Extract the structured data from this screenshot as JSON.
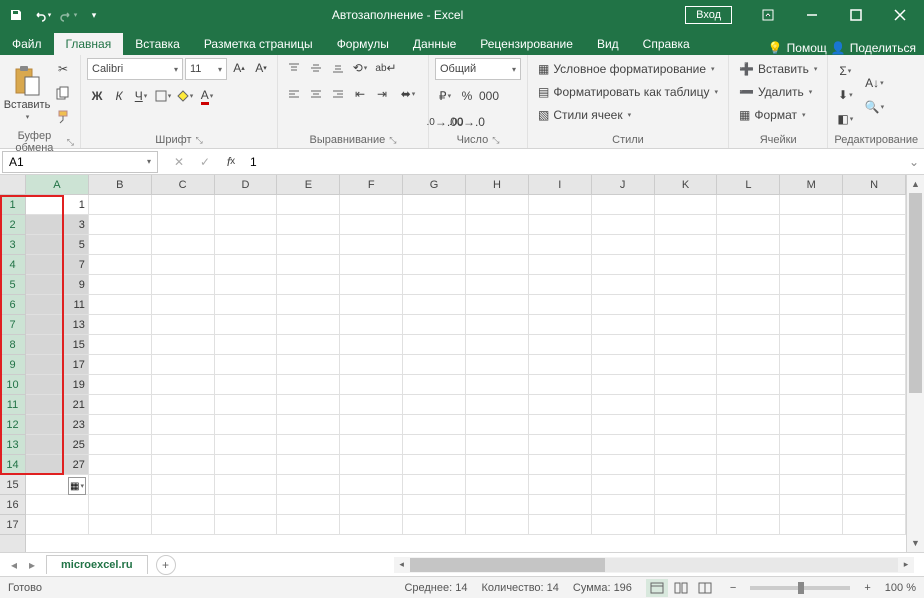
{
  "title": "Автозаполнение  -  Excel",
  "login": "Вход",
  "tabs": {
    "file": "Файл",
    "home": "Главная",
    "insert": "Вставка",
    "layout": "Разметка страницы",
    "formulas": "Формулы",
    "data": "Данные",
    "review": "Рецензирование",
    "view": "Вид",
    "help": "Справка",
    "tellme": "Помощ",
    "share": "Поделиться"
  },
  "ribbon": {
    "clipboard": {
      "paste": "Вставить",
      "label": "Буфер обмена"
    },
    "font": {
      "name": "Calibri",
      "size": "11",
      "label": "Шрифт"
    },
    "align": {
      "label": "Выравнивание"
    },
    "number": {
      "format": "Общий",
      "label": "Число"
    },
    "styles": {
      "cond": "Условное форматирование",
      "table": "Форматировать как таблицу",
      "cell": "Стили ячеек",
      "label": "Стили"
    },
    "cells": {
      "insert": "Вставить",
      "delete": "Удалить",
      "format": "Формат",
      "label": "Ячейки"
    },
    "editing": {
      "label": "Редактирование"
    }
  },
  "namebox": "A1",
  "formula": "1",
  "columns": [
    "A",
    "B",
    "C",
    "D",
    "E",
    "F",
    "G",
    "H",
    "I",
    "J",
    "K",
    "L",
    "M",
    "N"
  ],
  "rows": [
    1,
    2,
    3,
    4,
    5,
    6,
    7,
    8,
    9,
    10,
    11,
    12,
    13,
    14,
    15,
    16,
    17
  ],
  "cellData": {
    "A1": "1",
    "A2": "3",
    "A3": "5",
    "A4": "7",
    "A5": "9",
    "A6": "11",
    "A7": "13",
    "A8": "15",
    "A9": "17",
    "A10": "19",
    "A11": "21",
    "A12": "23",
    "A13": "25",
    "A14": "27"
  },
  "sheet": "microexcel.ru",
  "status": {
    "ready": "Готово",
    "avg": "Среднее: 14",
    "count": "Количество: 14",
    "sum": "Сумма: 196",
    "zoom": "100 %"
  }
}
